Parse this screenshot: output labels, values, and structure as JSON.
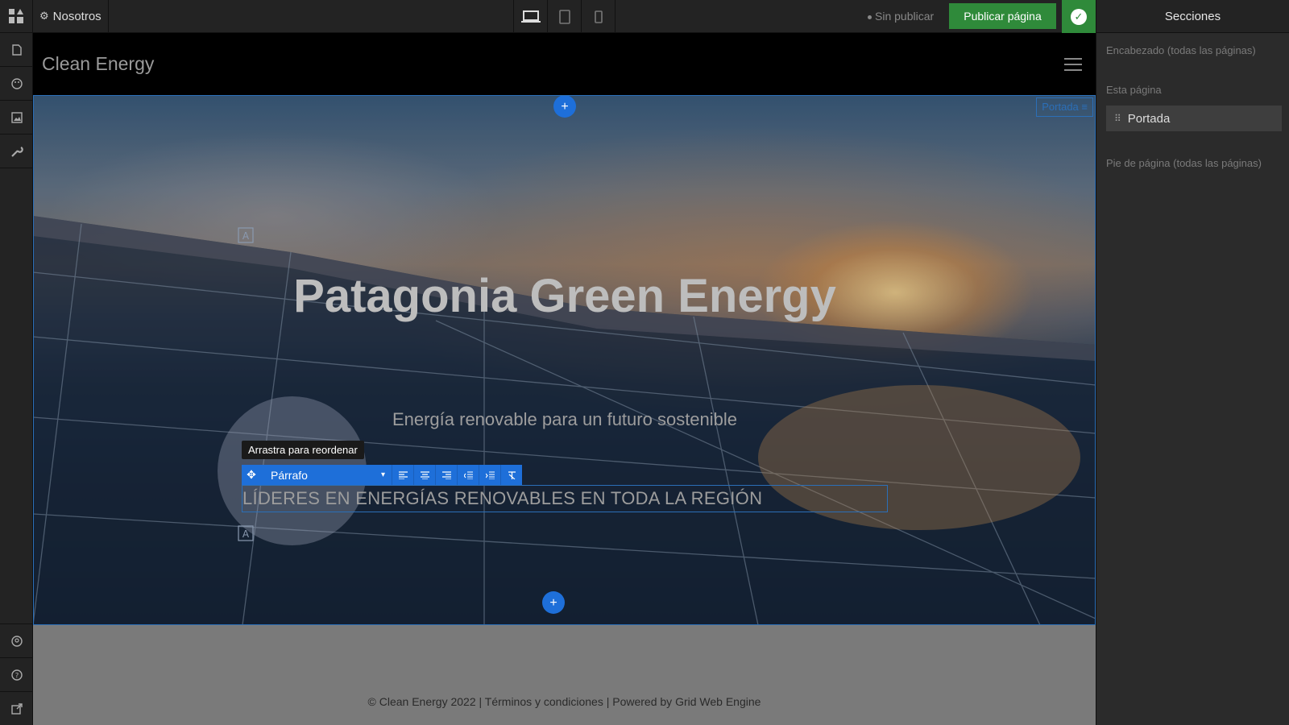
{
  "topbar": {
    "page_name": "Nosotros",
    "status": "Sin publicar",
    "publish_label": "Publicar página"
  },
  "site": {
    "logo_text": "Clean Energy",
    "hero_title": "Patagonia Green Energy",
    "hero_subtitle": "Energía renovable para un futuro sostenible",
    "hero_paragraph": "LÍDERES EN ENERGÍAS RENOVABLES EN TODA LA REGIÓN",
    "section_tag": "Portada",
    "footer_text": "© Clean Energy 2022 | Términos y condiciones | Powered by Grid Web Engine"
  },
  "editor": {
    "tooltip": "Arrastra para reordenar",
    "block_type": "Párrafo",
    "add_label": "+"
  },
  "sections_panel": {
    "title": "Secciones",
    "header_label": "Encabezado (todas las páginas)",
    "this_page_label": "Esta página",
    "items": [
      {
        "label": "Portada"
      }
    ],
    "footer_label": "Pie de página (todas las páginas)"
  },
  "colors": {
    "accent": "#1e6fd9",
    "publish": "#2f8a3a"
  }
}
